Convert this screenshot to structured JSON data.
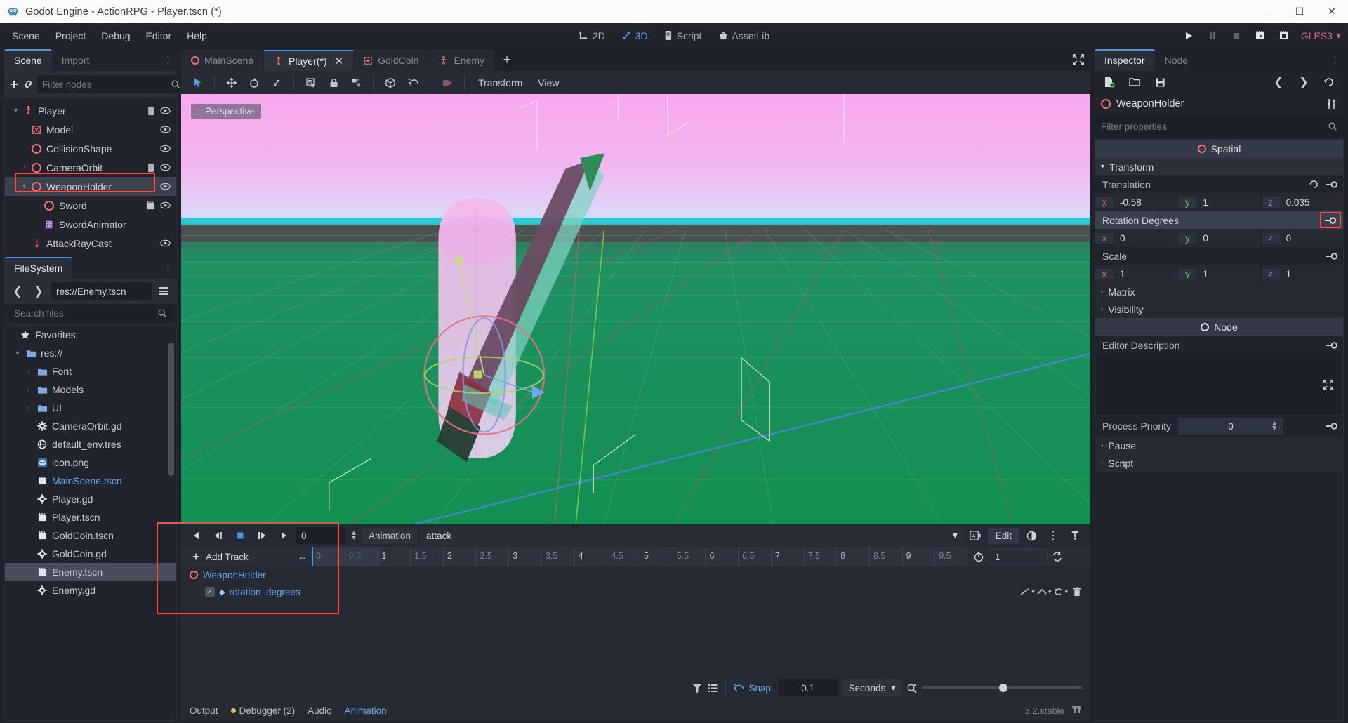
{
  "window": {
    "title": "Godot Engine - ActionRPG - Player.tscn (*)",
    "controls": {
      "minimize": "–",
      "maximize": "☐",
      "close": "✕"
    }
  },
  "menubar": {
    "items": [
      "Scene",
      "Project",
      "Debug",
      "Editor",
      "Help"
    ],
    "center_modes": [
      {
        "label": "2D",
        "icon": "move-2d-icon",
        "active": false
      },
      {
        "label": "3D",
        "icon": "move-3d-icon",
        "active": true
      },
      {
        "label": "Script",
        "icon": "script-icon",
        "active": false
      },
      {
        "label": "AssetLib",
        "icon": "assetlib-icon",
        "active": false
      }
    ],
    "playback": [
      {
        "name": "play-button",
        "glyph": "▶"
      },
      {
        "name": "pause-button",
        "glyph": "❚❚"
      },
      {
        "name": "stop-button",
        "glyph": "■"
      },
      {
        "name": "play-scene-button",
        "glyph": "▶"
      },
      {
        "name": "play-custom-scene-button",
        "glyph": "□"
      }
    ],
    "renderer": "GLES3"
  },
  "scene_dock": {
    "tabs": [
      {
        "label": "Scene",
        "active": true
      },
      {
        "label": "Import",
        "active": false
      }
    ],
    "toolbar": {
      "add_icon": "plus-icon",
      "link_icon": "link-icon"
    },
    "filter_placeholder": "Filter nodes",
    "nodes": [
      {
        "label": "Player",
        "icon": "kinematicbody-icon",
        "indent": 0,
        "expander": "∨",
        "script": true,
        "visible": true,
        "selected": false
      },
      {
        "label": "Model",
        "icon": "meshinstance-icon",
        "indent": 1,
        "expander": "",
        "script": false,
        "visible": true,
        "selected": false
      },
      {
        "label": "CollisionShape",
        "icon": "spatial-icon",
        "indent": 1,
        "expander": "",
        "script": false,
        "visible": true,
        "selected": false
      },
      {
        "label": "CameraOrbit",
        "icon": "spatial-icon",
        "indent": 1,
        "expander": "›",
        "script": true,
        "visible": true,
        "selected": false
      },
      {
        "label": "WeaponHolder",
        "icon": "spatial-icon",
        "indent": 1,
        "expander": "∨",
        "script": false,
        "visible": true,
        "selected": true
      },
      {
        "label": "Sword",
        "icon": "spatial-icon",
        "indent": 2,
        "expander": "",
        "script": false,
        "visible": true,
        "selected": false,
        "scene_icon": true
      },
      {
        "label": "SwordAnimator",
        "icon": "animationplayer-icon",
        "indent": 2,
        "expander": "",
        "script": false,
        "visible": false,
        "selected": false
      },
      {
        "label": "AttackRayCast",
        "icon": "raycast-icon",
        "indent": 1,
        "expander": "",
        "script": false,
        "visible": true,
        "selected": false
      }
    ]
  },
  "filesystem_dock": {
    "tab": "FileSystem",
    "path": "res://Enemy.tscn",
    "search_placeholder": "Search files",
    "items": [
      {
        "label": "Favorites:",
        "icon": "star-icon",
        "indent": 0,
        "expander": "",
        "type": "label"
      },
      {
        "label": "res://",
        "icon": "folder-icon",
        "indent": 0,
        "expander": "∨",
        "type": "folder"
      },
      {
        "label": "Font",
        "icon": "folder-icon",
        "indent": 1,
        "expander": "›",
        "type": "folder"
      },
      {
        "label": "Models",
        "icon": "folder-icon",
        "indent": 1,
        "expander": "›",
        "type": "folder"
      },
      {
        "label": "UI",
        "icon": "folder-icon",
        "indent": 1,
        "expander": "›",
        "type": "folder"
      },
      {
        "label": "CameraOrbit.gd",
        "icon": "gdscript-icon",
        "indent": 1,
        "expander": "",
        "type": "file"
      },
      {
        "label": "default_env.tres",
        "icon": "resource-icon",
        "indent": 1,
        "expander": "",
        "type": "file"
      },
      {
        "label": "icon.png",
        "icon": "image-icon",
        "indent": 1,
        "expander": "",
        "type": "file"
      },
      {
        "label": "MainScene.tscn",
        "icon": "scene-icon",
        "indent": 1,
        "expander": "",
        "type": "file",
        "open": true
      },
      {
        "label": "Player.gd",
        "icon": "gdscript-icon",
        "indent": 1,
        "expander": "",
        "type": "file"
      },
      {
        "label": "Player.tscn",
        "icon": "scene-icon",
        "indent": 1,
        "expander": "",
        "type": "file"
      },
      {
        "label": "GoldCoin.tscn",
        "icon": "scene-icon",
        "indent": 1,
        "expander": "",
        "type": "file"
      },
      {
        "label": "GoldCoin.gd",
        "icon": "gdscript-icon",
        "indent": 1,
        "expander": "",
        "type": "file"
      },
      {
        "label": "Enemy.tscn",
        "icon": "scene-icon",
        "indent": 1,
        "expander": "",
        "type": "file",
        "selected": true
      },
      {
        "label": "Enemy.gd",
        "icon": "gdscript-icon",
        "indent": 1,
        "expander": "",
        "type": "file"
      }
    ]
  },
  "scene_tabs": [
    {
      "label": "MainScene",
      "icon": "spatial-icon",
      "active": false,
      "closable": false
    },
    {
      "label": "Player(*)",
      "icon": "kinematicbody-icon",
      "active": true,
      "closable": true
    },
    {
      "label": "GoldCoin",
      "icon": "area-icon",
      "active": false,
      "closable": false
    },
    {
      "label": "Enemy",
      "icon": "kinematicbody-icon",
      "active": false,
      "closable": false
    }
  ],
  "scene_tabs_add": "+",
  "viewport_toolbar": {
    "tools": [
      {
        "name": "select-mode-button",
        "glyph": "➤",
        "active": true
      },
      {
        "name": "move-mode-button",
        "glyph": "move"
      },
      {
        "name": "rotate-mode-button",
        "glyph": "rotate"
      },
      {
        "name": "scale-mode-button",
        "glyph": "scale"
      },
      {
        "name": "list-select-button",
        "glyph": "list"
      },
      {
        "name": "lock-button",
        "glyph": "lock"
      },
      {
        "name": "group-button",
        "glyph": "group"
      },
      {
        "name": "local-space-button",
        "glyph": "cube"
      },
      {
        "name": "snap-mode-button",
        "glyph": "magnet"
      },
      {
        "name": "camera-preview-button",
        "glyph": "camera"
      }
    ],
    "menus": [
      "Transform",
      "View"
    ],
    "fullscreen_icon": "expand-icon"
  },
  "viewport": {
    "perspective_label": "Perspective"
  },
  "inspector": {
    "tabs": [
      {
        "label": "Inspector",
        "active": true
      },
      {
        "label": "Node",
        "active": false
      }
    ],
    "toolbar_icons": [
      "new-resource-icon",
      "open-resource-icon",
      "save-resource-icon",
      "back-icon",
      "forward-icon",
      "history-icon"
    ],
    "node_name": "WeaponHolder",
    "tools_icon": "object-tools-icon",
    "filter_placeholder": "Filter properties",
    "spatial_category": "Spatial",
    "transform_section": "Transform",
    "properties": [
      {
        "label": "Translation",
        "highlighted": false,
        "has_revert": true,
        "has_key": true,
        "key_outlined": false,
        "values": [
          {
            "axis": "x",
            "value": "-0.58"
          },
          {
            "axis": "y",
            "value": "1"
          },
          {
            "axis": "z",
            "value": "0.035"
          }
        ]
      },
      {
        "label": "Rotation Degrees",
        "highlighted": true,
        "has_revert": false,
        "has_key": true,
        "key_outlined": true,
        "values": [
          {
            "axis": "x",
            "value": "0"
          },
          {
            "axis": "y",
            "value": "0"
          },
          {
            "axis": "z",
            "value": "0"
          }
        ]
      },
      {
        "label": "Scale",
        "highlighted": false,
        "has_revert": false,
        "has_key": true,
        "key_outlined": false,
        "values": [
          {
            "axis": "x",
            "value": "1"
          },
          {
            "axis": "y",
            "value": "1"
          },
          {
            "axis": "z",
            "value": "1"
          }
        ]
      }
    ],
    "subsections": [
      "Matrix",
      "Visibility"
    ],
    "node_category": "Node",
    "editor_description_label": "Editor Description",
    "editor_description_value": "",
    "process_priority_label": "Process Priority",
    "process_priority_value": "0",
    "tail_sections": [
      "Pause",
      "Script"
    ]
  },
  "animation_panel": {
    "transport": [
      {
        "name": "play-backwards-button",
        "glyph": "◀"
      },
      {
        "name": "previous-frame-button",
        "glyph": "◀▐"
      },
      {
        "name": "stop-button",
        "glyph": "■"
      },
      {
        "name": "next-frame-button",
        "glyph": "▌▶"
      },
      {
        "name": "play-button",
        "glyph": "▶"
      }
    ],
    "time_value": "0",
    "animation_label": "Animation",
    "animation_name": "attack",
    "onion_icon": "onion-skin-icon",
    "edit_label": "Edit",
    "blend_icon": "blend-icon",
    "menu_icon": "vertical-dots-icon",
    "pin_icon": "pin-icon",
    "add_track_label": "Add Track",
    "ruler_ticks": [
      "0",
      "0.5",
      "1",
      "1.5",
      "2",
      "2.5",
      "3",
      "3.5",
      "4",
      "4.5",
      "5",
      "5.5",
      "6",
      "6.5",
      "7",
      "7.5",
      "8",
      "8.5",
      "9",
      "9.5"
    ],
    "loop_length_value": "1",
    "loop_icon": "loop-icon",
    "timer_icon": "timer-icon",
    "tracks": [
      {
        "type": "node",
        "label": "WeaponHolder",
        "icon": "spatial-icon"
      },
      {
        "type": "property",
        "label": "rotation_degrees",
        "checked": true,
        "icon": "value-track-icon"
      }
    ],
    "track_tools": [
      "interpolation-icon",
      "loop-wrap-icon",
      "update-mode-icon",
      "delete-track-icon"
    ],
    "bottom": {
      "filter_icon": "filter-icon",
      "list_icon": "track-list-icon",
      "snap_label": "Snap:",
      "snap_value": "0.1",
      "unit": "Seconds",
      "zoom_icon": "zoom-icon"
    }
  },
  "status_bar": {
    "tabs": [
      {
        "label": "Output",
        "active": false,
        "dot": false
      },
      {
        "label": "Debugger (2)",
        "active": false,
        "dot": true
      },
      {
        "label": "Audio",
        "active": false,
        "dot": false
      },
      {
        "label": "Animation",
        "active": true,
        "dot": false
      }
    ],
    "version": "3.2.stable",
    "layout_icon": "expand-bottom-icon"
  },
  "colors": {
    "accent_blue": "#6ba6e8",
    "highlight_red": "#fc4b45",
    "panel_bg": "#21242c",
    "editor_bg": "#1f2229",
    "gles_pink": "#d4628b"
  }
}
